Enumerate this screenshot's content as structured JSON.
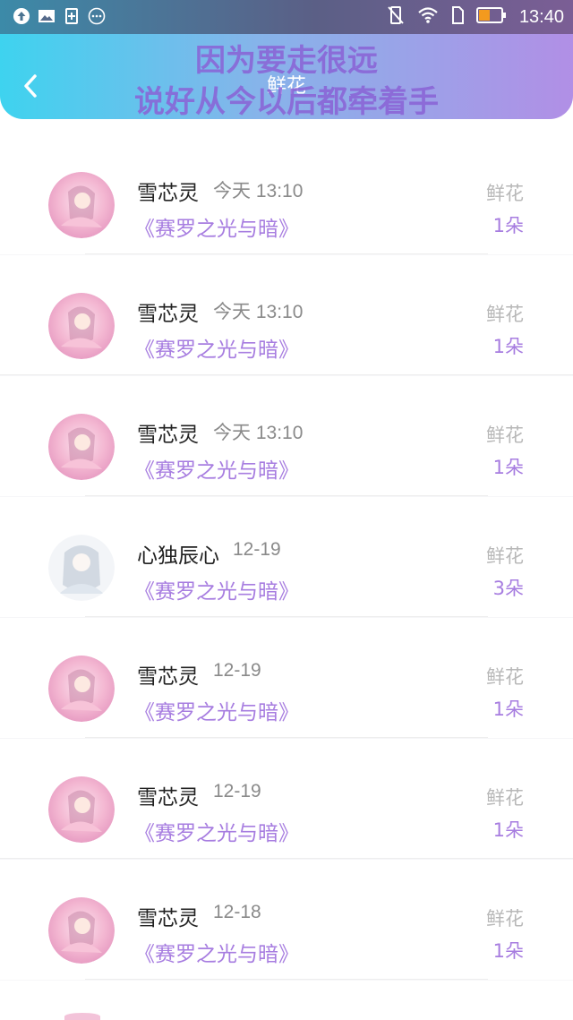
{
  "status_bar": {
    "time": "13:40"
  },
  "header": {
    "title": "鲜花",
    "overlay_line1": "因为要走很远",
    "overlay_line2": "说好从今以后都牵着手"
  },
  "items": [
    {
      "name": "雪芯灵",
      "time": "今天 13:10",
      "book": "《赛罗之光与暗》",
      "kind": "鲜花",
      "count": "1朵",
      "avatar": "pink-girl"
    },
    {
      "name": "雪芯灵",
      "time": "今天 13:10",
      "book": "《赛罗之光与暗》",
      "kind": "鲜花",
      "count": "1朵",
      "avatar": "pink-girl"
    },
    {
      "name": "雪芯灵",
      "time": "今天 13:10",
      "book": "《赛罗之光与暗》",
      "kind": "鲜花",
      "count": "1朵",
      "avatar": "pink-girl"
    },
    {
      "name": "心独辰心",
      "time": "12-19",
      "book": "《赛罗之光与暗》",
      "kind": "鲜花",
      "count": "3朵",
      "avatar": "white-girl"
    },
    {
      "name": "雪芯灵",
      "time": "12-19",
      "book": "《赛罗之光与暗》",
      "kind": "鲜花",
      "count": "1朵",
      "avatar": "pink-girl"
    },
    {
      "name": "雪芯灵",
      "time": "12-19",
      "book": "《赛罗之光与暗》",
      "kind": "鲜花",
      "count": "1朵",
      "avatar": "pink-girl"
    },
    {
      "name": "雪芯灵",
      "time": "12-18",
      "book": "《赛罗之光与暗》",
      "kind": "鲜花",
      "count": "1朵",
      "avatar": "pink-girl"
    }
  ]
}
